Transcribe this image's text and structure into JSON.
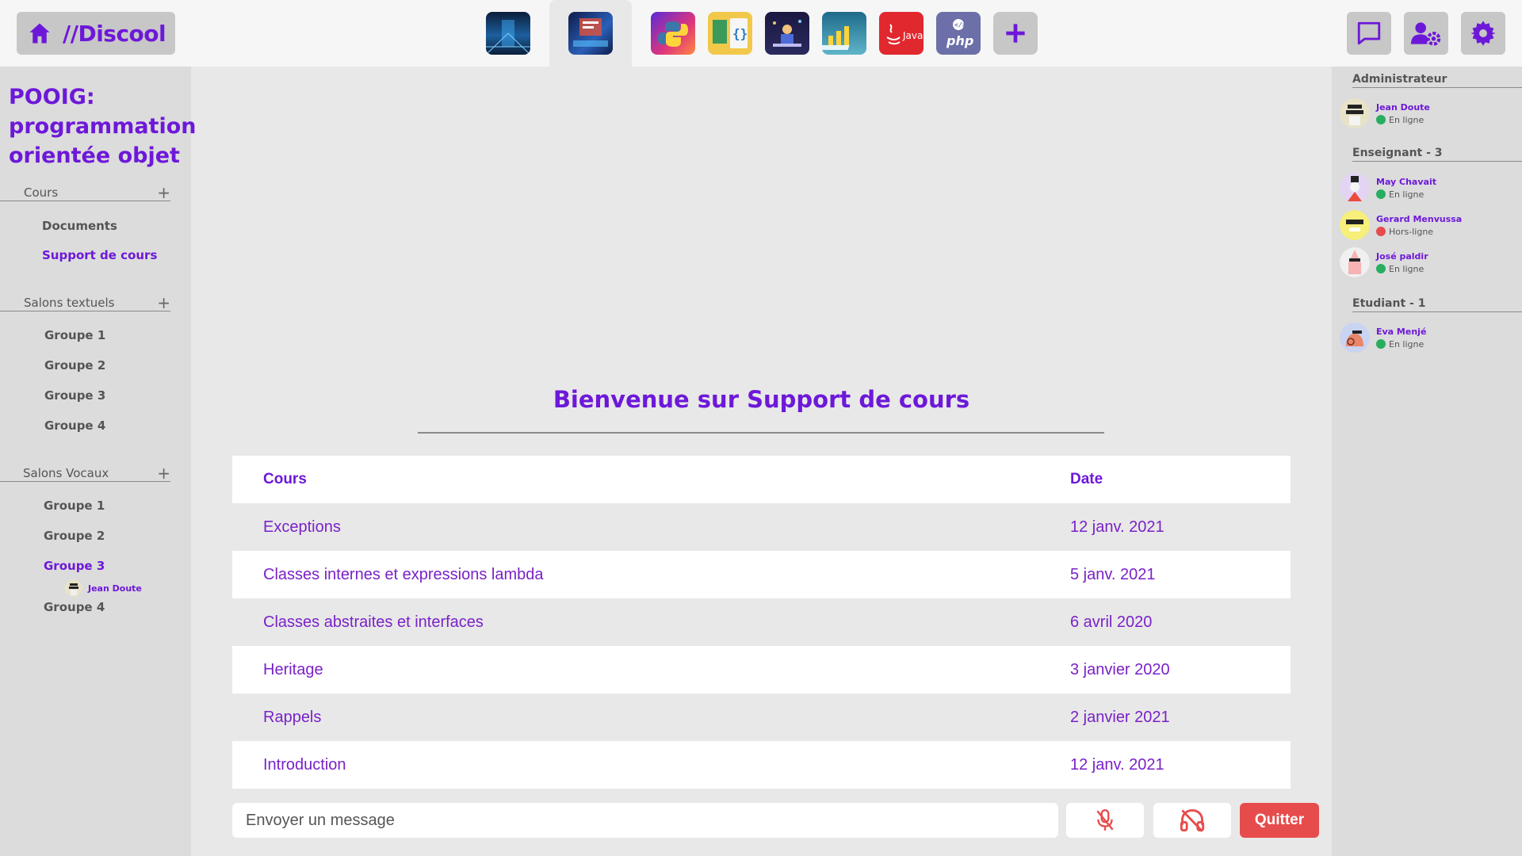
{
  "app": {
    "logo": "//Discool",
    "accent": "#6d18d9",
    "danger": "#e74c4c",
    "online": "#27ae60",
    "offline": "#e74c4c"
  },
  "servers": [
    {
      "name": "server-1",
      "icon": "server-room-image"
    },
    {
      "name": "server-2",
      "icon": "code-screen-image",
      "active": true
    },
    {
      "name": "server-3",
      "icon": "python-logo"
    },
    {
      "name": "server-4",
      "icon": "code-editor-image"
    },
    {
      "name": "server-5",
      "icon": "developer-illustration"
    },
    {
      "name": "server-6",
      "icon": "charts-illustration"
    },
    {
      "name": "server-7",
      "icon": "java-logo",
      "label": "Java"
    },
    {
      "name": "server-8",
      "icon": "php-logo",
      "label": "php"
    },
    {
      "name": "add-server",
      "icon": "plus-icon",
      "label": "+"
    }
  ],
  "top_actions": [
    "chat-icon",
    "user-settings-icon",
    "gear-icon"
  ],
  "sidebar": {
    "course_title": "POOIG: programmation orientée objet",
    "sections": [
      {
        "title": "Cours",
        "add": "+",
        "items": [
          "Documents",
          "Support de cours"
        ],
        "active": "Support de cours"
      },
      {
        "title": "Salons textuels",
        "add": "+",
        "items": [
          "Groupe 1",
          "Groupe 2",
          "Groupe 3",
          "Groupe 4"
        ]
      },
      {
        "title": "Salons Vocaux",
        "add": "+",
        "items": [
          "Groupe 1",
          "Groupe 2",
          "Groupe 3",
          "Groupe 4"
        ],
        "active": "Groupe 3",
        "voice_user": "Jean Doute"
      }
    ]
  },
  "main": {
    "welcome": "Bienvenue sur Support de cours",
    "table": {
      "headers": [
        "Cours",
        "Date"
      ],
      "rows": [
        [
          "Exceptions",
          "12 janv. 2021"
        ],
        [
          "Classes internes et expressions lambda",
          "5 janv. 2021"
        ],
        [
          "Classes abstraites et interfaces",
          "6 avril 2020"
        ],
        [
          "Heritage",
          "3 janvier 2020"
        ],
        [
          "Rappels",
          "2 janvier 2021"
        ],
        [
          "Introduction",
          "12 janv. 2021"
        ]
      ]
    },
    "message_placeholder": "Envoyer un message",
    "quit_label": "Quitter",
    "controls": [
      "mic-muted-icon",
      "headphones-muted-icon"
    ]
  },
  "members": {
    "groups": [
      {
        "title": "Administrateur",
        "members": [
          {
            "name": "Jean Doute",
            "status": "En ligne",
            "online": true
          }
        ]
      },
      {
        "title": "Enseignant - 3",
        "members": [
          {
            "name": "May Chavait",
            "status": "En ligne",
            "online": true
          },
          {
            "name": "Gerard Menvussa",
            "status": "Hors-ligne",
            "online": false
          },
          {
            "name": "José paldir",
            "status": "En ligne",
            "online": true
          }
        ]
      },
      {
        "title": "Etudiant - 1",
        "members": [
          {
            "name": "Eva Menjé",
            "status": "En ligne",
            "online": true
          }
        ]
      }
    ]
  }
}
